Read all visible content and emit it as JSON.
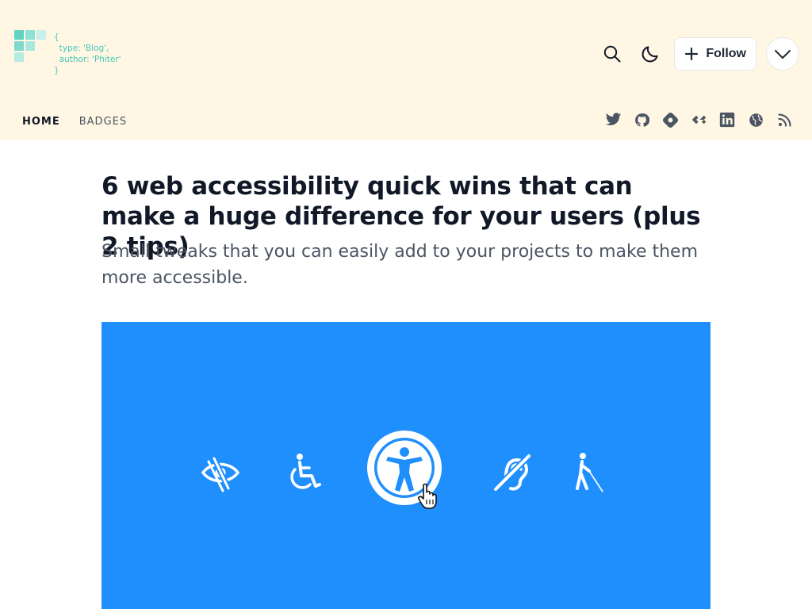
{
  "logo": {
    "code_open": "{",
    "code_line_1": "  type: 'Blog',",
    "code_line_2": "  author: 'Phiter'",
    "code_close": "}",
    "tile_color": "#43c7b8"
  },
  "header": {
    "follow_label": "Follow",
    "search_icon": "search-icon",
    "theme_icon": "moon-icon",
    "more_icon": "chevron-down-icon",
    "background": "#fff7e4"
  },
  "nav": {
    "items": [
      {
        "label": "HOME",
        "active": true
      },
      {
        "label": "BADGES",
        "active": false
      }
    ]
  },
  "social": [
    "twitter-icon",
    "github-icon",
    "hashnode-icon",
    "devto-icon",
    "linkedin-icon",
    "globe-icon",
    "rss-icon"
  ],
  "article": {
    "title": "6 web accessibility quick wins that can make a huge difference for your users (plus 2 tips)",
    "subtitle": "Small tweaks that you can easily add to your projects to make them more accessible.",
    "cover": {
      "background": "#1f8ffd",
      "icons": [
        "low-vision-icon",
        "wheelchair-icon",
        "universal-access-icon",
        "hearing-loss-icon",
        "blind-cane-icon",
        "hand-cursor-icon"
      ]
    }
  }
}
